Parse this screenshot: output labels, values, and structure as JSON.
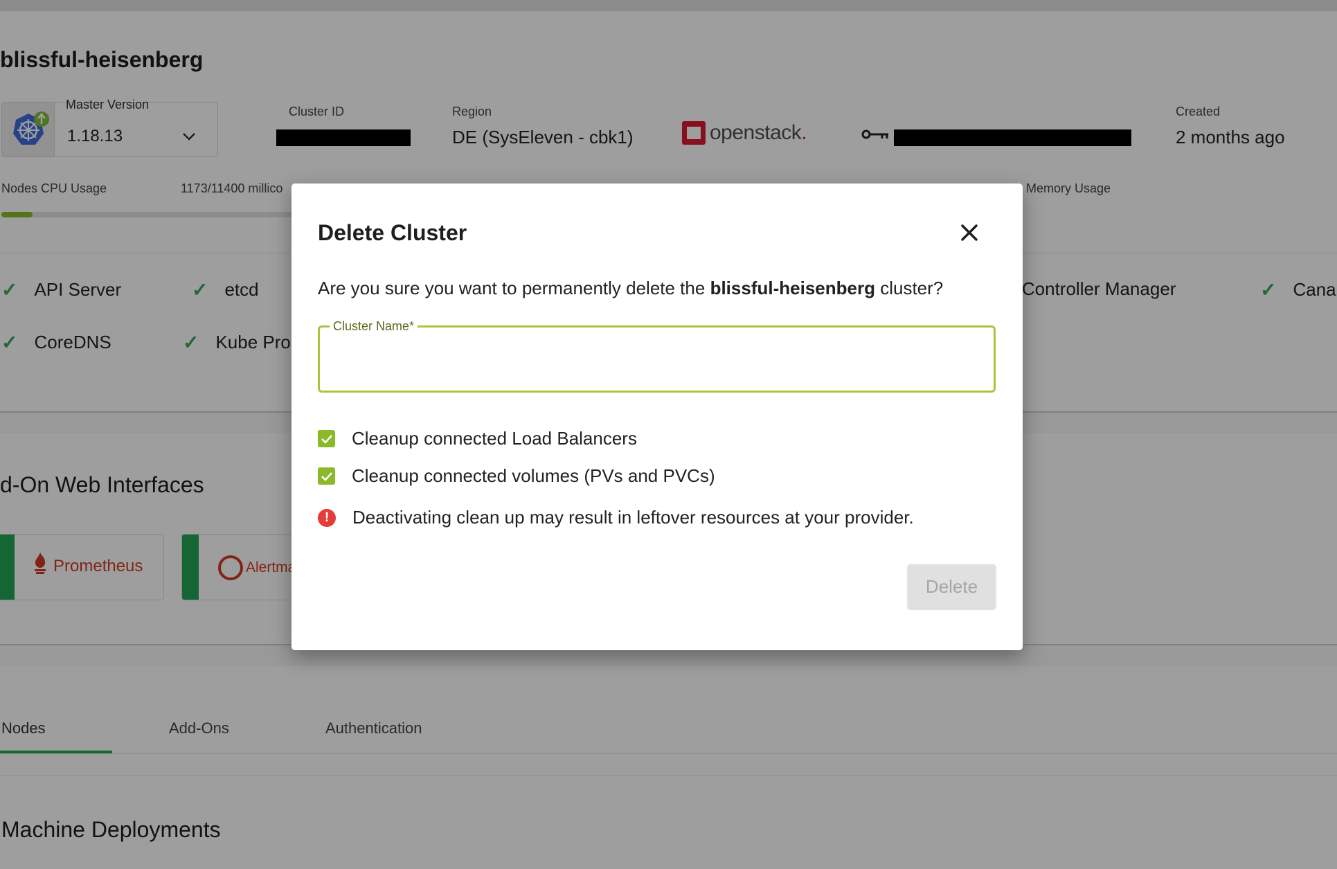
{
  "cluster": {
    "name": "blissful-heisenberg",
    "master_version_label": "Master Version",
    "master_version_value": "1.18.13",
    "cluster_id_label": "Cluster ID",
    "region_label": "Region",
    "region_value": "DE (SysEleven - cbk1)",
    "provider_logo_text": "openstack",
    "provider_logo_dot": ".",
    "created_label": "Created",
    "created_value": "2 months ago",
    "cpu_label": "Nodes CPU Usage",
    "cpu_value": "1173/11400 millico",
    "cpu_usage_fraction": 0.103,
    "memory_label": "Memory Usage",
    "status_items": [
      {
        "label": "API Server"
      },
      {
        "label": "etcd"
      },
      {
        "label": "r Controller Manager"
      },
      {
        "label": "Cana"
      },
      {
        "label": "CoreDNS"
      },
      {
        "label": "Kube Pro"
      }
    ]
  },
  "addons": {
    "title": "d-On Web Interfaces",
    "tiles": [
      {
        "label": "Prometheus"
      },
      {
        "label": "Alertma"
      }
    ]
  },
  "tabs": [
    {
      "label": "Nodes",
      "active": true
    },
    {
      "label": "Add-Ons",
      "active": false
    },
    {
      "label": "Authentication",
      "active": false
    }
  ],
  "machine_deployments_title": "Machine Deployments",
  "dialog": {
    "title": "Delete Cluster",
    "question_prefix": "Are you sure you want to permanently delete the",
    "question_name": "blissful-heisenberg",
    "question_suffix": "cluster?",
    "field_label": "Cluster Name*",
    "field_value": "",
    "checkbox_lb_label": "Cleanup connected Load Balancers",
    "checkbox_lb_checked": true,
    "checkbox_vol_label": "Cleanup connected volumes (PVs and PVCs)",
    "checkbox_vol_checked": true,
    "warning_text": "Deactivating clean up may result in leftover resources at your provider.",
    "delete_label": "Delete",
    "delete_enabled": false
  },
  "colors": {
    "accent_green": "#8aba2a",
    "tab_green": "#22a356",
    "warning_red": "#e43b3b",
    "openstack_red": "#da1a32"
  }
}
